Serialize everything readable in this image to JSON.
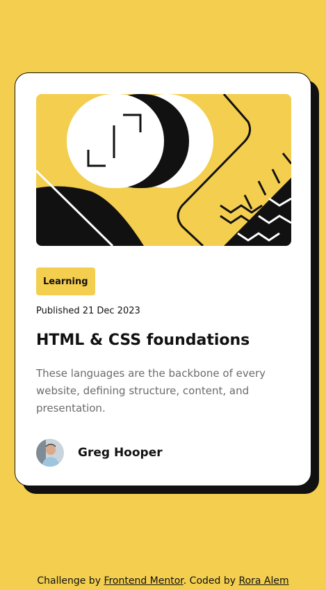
{
  "colors": {
    "background": "#F4CE4F",
    "card": "#FFFFFF",
    "ink": "#111111",
    "muted_text": "#6B6B6B"
  },
  "card": {
    "tag": "Learning",
    "published": "Published 21 Dec 2023",
    "title": "HTML & CSS foundations",
    "description": "These languages are the backbone of every website, defining structure, content, and presentation.",
    "author": {
      "name": "Greg Hooper",
      "avatar_icon": "avatar-photo"
    },
    "hero_icon": "abstract-illustration"
  },
  "footer": {
    "prefix": "Challenge by ",
    "link1": "Frontend Mentor",
    "middle": ". Coded by ",
    "link2": "Rora Alem"
  }
}
